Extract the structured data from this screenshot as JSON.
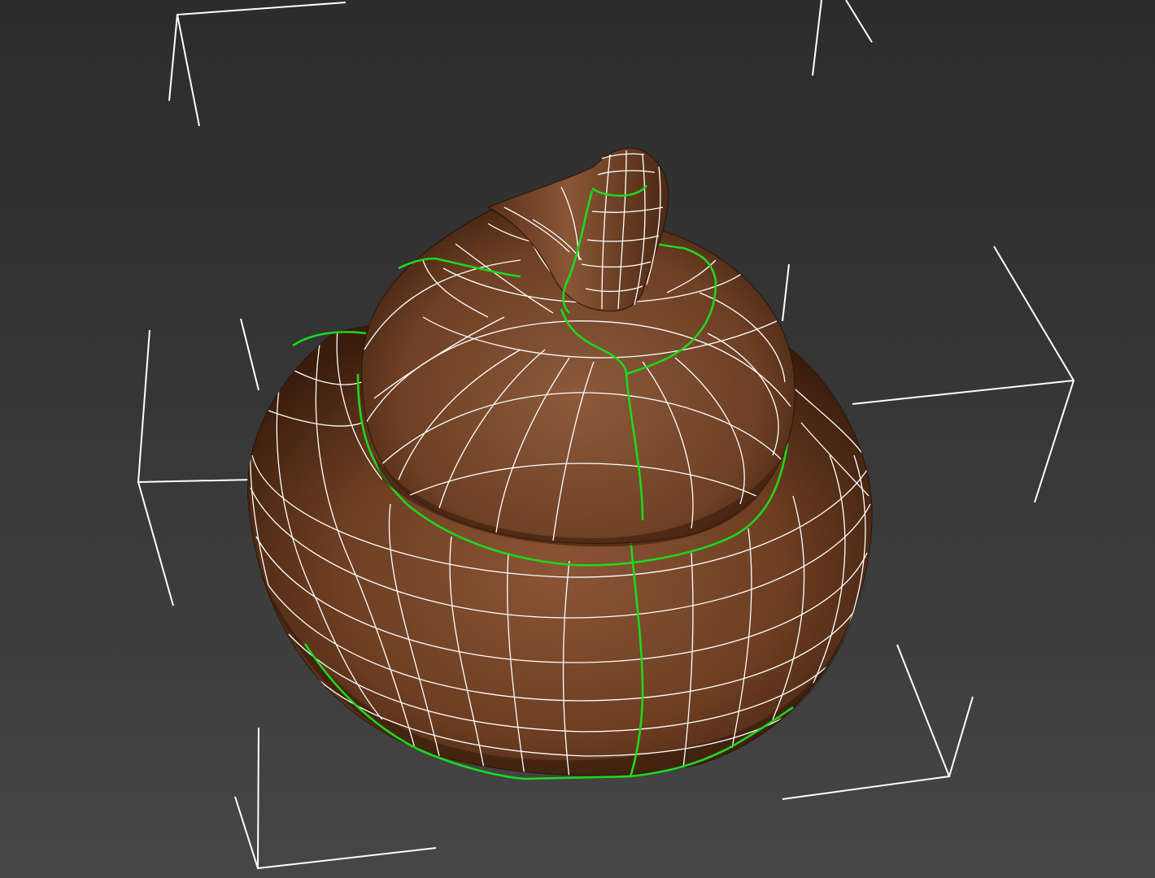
{
  "viewport": {
    "background_top": "#2c2c2c",
    "background_bottom": "#464646",
    "bounding_box_color": "#ffffff",
    "wire_color": "#ffffff",
    "selected_edge_color": "#1ed81e"
  },
  "model": {
    "icon": "poop-emoji-mesh",
    "shading": "smooth",
    "tiers": [
      "base-tier",
      "middle-tier",
      "top-tier",
      "tip"
    ],
    "base_color": "#6e3e22",
    "highlight_color": "#8a5535",
    "shadow_color": "#2e170a"
  }
}
